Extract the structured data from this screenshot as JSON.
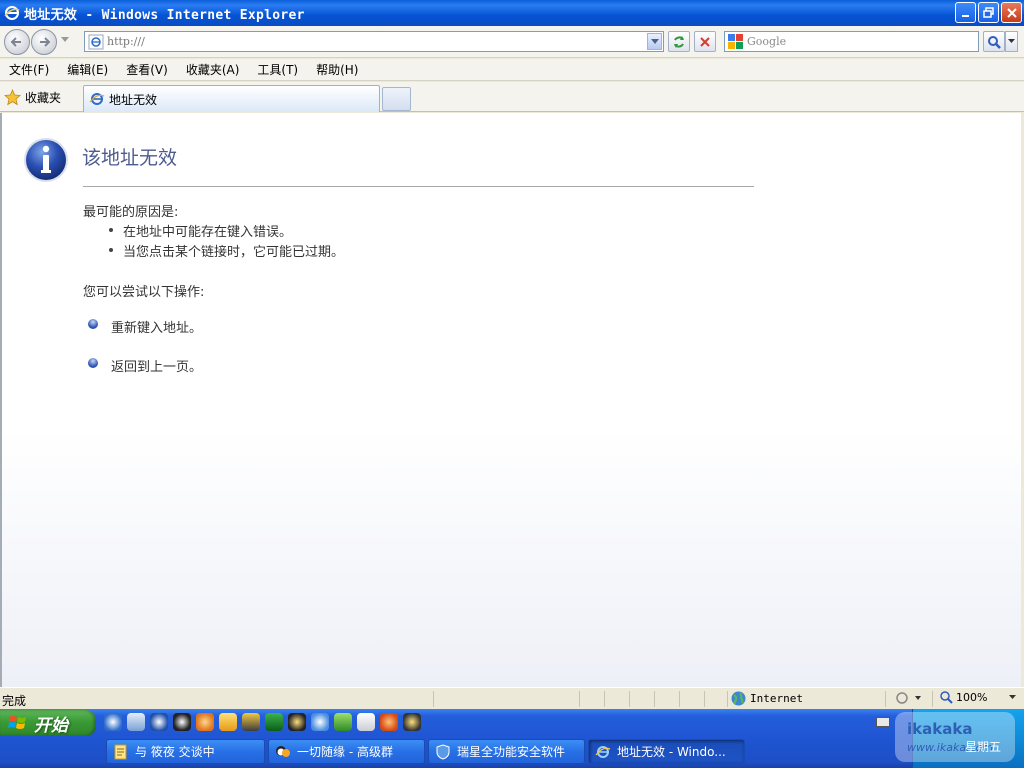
{
  "window": {
    "title": "地址无效 - Windows Internet Explorer"
  },
  "address_bar": {
    "url": "http:///"
  },
  "search": {
    "placeholder": "Google"
  },
  "menu": {
    "items": [
      "文件(F)",
      "编辑(E)",
      "查看(V)",
      "收藏夹(A)",
      "工具(T)",
      "帮助(H)"
    ]
  },
  "tabs": {
    "favorites_label": "收藏夹",
    "active_tab_label": "地址无效"
  },
  "error_page": {
    "title": "该地址无效",
    "reasons_heading": "最可能的原因是:",
    "reasons": [
      "在地址中可能存在键入错误。",
      "当您点击某个链接时，它可能已过期。"
    ],
    "actions_heading": "您可以尝试以下操作:",
    "actions": [
      "重新键入地址。",
      "返回到上一页。"
    ]
  },
  "status_bar": {
    "status": "完成",
    "zone": "Internet",
    "zoom": "100%"
  },
  "taskbar": {
    "start_label": "开始",
    "buttons": [
      "与 筱夜 交谈中",
      "一切随缘 - 高级群",
      "瑞星全功能安全软件",
      "地址无效 - Windo..."
    ],
    "watermark_line1": "ikakaka",
    "watermark_line2": "www.ikaka.com",
    "day": "星期五"
  },
  "colors": {
    "title_gradient": "#0553D3",
    "error_title": "#4E5B8F",
    "taskbar": "#245EDB",
    "start_green": "#3A9A35"
  }
}
